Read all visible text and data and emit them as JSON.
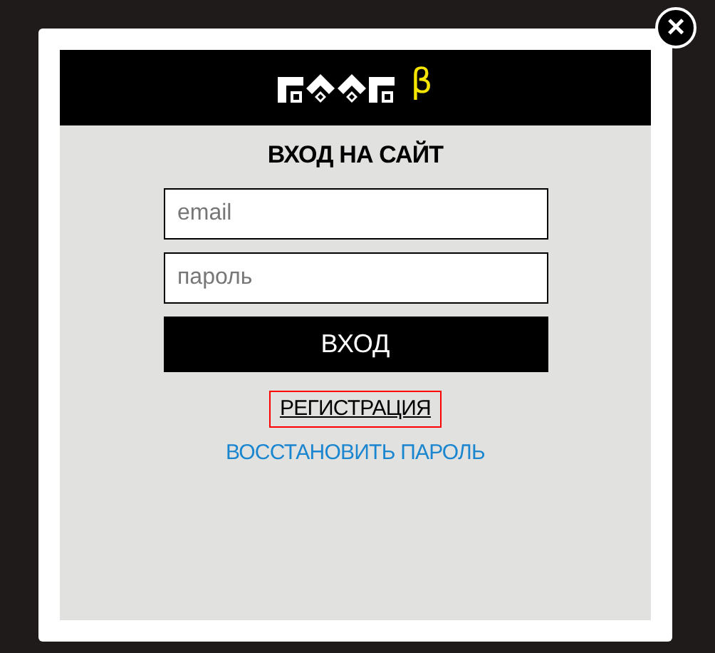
{
  "logo": {
    "badge": "β"
  },
  "title": "ВХОД НА САЙТ",
  "fields": [
    {
      "placeholder": "email"
    },
    {
      "placeholder": "пароль"
    }
  ],
  "submit_button": "ВХОД",
  "register_link": {
    "label": "РЕГИСТРАЦИЯ",
    "selected": true
  },
  "restore_link": "ВОССТАНОВИТЬ ПАРОЛЬ",
  "close_button": "×"
}
